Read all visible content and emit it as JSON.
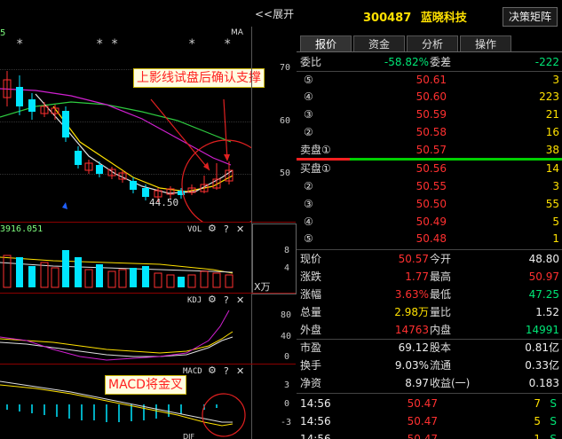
{
  "header": {
    "expand_label": "<<展开",
    "stock_code": "300487",
    "stock_name": "蓝晓科技",
    "decision_button": "决策矩阵"
  },
  "tabs": [
    {
      "label": "报价"
    },
    {
      "label": "资金"
    },
    {
      "label": "分析"
    },
    {
      "label": "操作"
    }
  ],
  "chart": {
    "ma_label": "MA",
    "price_axis": [
      "70",
      "60",
      "50"
    ],
    "low_label": "44.50",
    "vol_value": "3916.051",
    "vol_tag": "VOL",
    "vol_axis": [
      "8",
      "4"
    ],
    "vol_unit": "X万",
    "kdj_tag": "KDJ",
    "kdj_axis": [
      "80",
      "40",
      "0"
    ],
    "macd_tag": "MACD",
    "macd_axis": [
      "3",
      "0",
      "-3"
    ],
    "top_corner": "5",
    "stars_left": "*",
    "stars_mid": "* *",
    "stars_right1": "*",
    "stars_right2": "*",
    "question": "?",
    "close": "✕",
    "bottom_tag": "DIF"
  },
  "annotations": {
    "upper_shadow": "上影线试盘后确认支撑",
    "macd_cross": "MACD将金叉"
  },
  "quote": {
    "wei_bi_label": "委比",
    "wei_bi": "-58.82%",
    "wei_cha_label": "委差",
    "wei_cha": "-222",
    "sell": [
      {
        "label": "⑤",
        "price": "50.61",
        "vol": "3"
      },
      {
        "label": "④",
        "price": "50.60",
        "vol": "223"
      },
      {
        "label": "③",
        "price": "50.59",
        "vol": "21"
      },
      {
        "label": "②",
        "price": "50.58",
        "vol": "16"
      },
      {
        "label": "卖盘①",
        "price": "50.57",
        "vol": "38"
      }
    ],
    "buy": [
      {
        "label": "买盘①",
        "price": "50.56",
        "vol": "14"
      },
      {
        "label": "②",
        "price": "50.55",
        "vol": "3"
      },
      {
        "label": "③",
        "price": "50.50",
        "vol": "55"
      },
      {
        "label": "④",
        "price": "50.49",
        "vol": "5"
      },
      {
        "label": "⑤",
        "price": "50.48",
        "vol": "1"
      }
    ],
    "stats": [
      {
        "l1": "现价",
        "v1": "50.57",
        "l2": "今开",
        "v2": "48.80",
        "c1": "red",
        "c2": "white"
      },
      {
        "l1": "涨跌",
        "v1": "1.77",
        "l2": "最高",
        "v2": "50.97",
        "c1": "red",
        "c2": "red"
      },
      {
        "l1": "涨幅",
        "v1": "3.63%",
        "l2": "最低",
        "v2": "47.25",
        "c1": "red",
        "c2": "green"
      },
      {
        "l1": "总量",
        "v1": "2.98万",
        "l2": "量比",
        "v2": "1.52",
        "c1": "yellow",
        "c2": "white"
      },
      {
        "l1": "外盘",
        "v1": "14763",
        "l2": "内盘",
        "v2": "14991",
        "c1": "red",
        "c2": "green"
      }
    ],
    "fund": [
      {
        "l1": "市盈",
        "v1": "69.12",
        "l2": "股本",
        "v2": "0.81亿"
      },
      {
        "l1": "换手",
        "v1": "9.03%",
        "l2": "流通",
        "v2": "0.33亿"
      },
      {
        "l1": "净资",
        "v1": "8.97",
        "l2": "收益(一)",
        "v2": "0.183"
      }
    ],
    "ticks": [
      {
        "time": "14:56",
        "price": "50.47",
        "vol": "7",
        "side": "S"
      },
      {
        "time": "14:56",
        "price": "50.47",
        "vol": "5",
        "side": "S"
      },
      {
        "time": "14:56",
        "price": "50.47",
        "vol": "1",
        "side": "S"
      }
    ]
  }
}
